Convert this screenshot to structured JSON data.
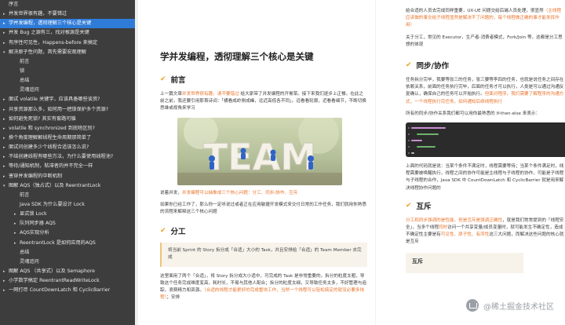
{
  "sidebar": {
    "items": [
      {
        "label": "序言",
        "level": 0,
        "tri": ""
      },
      {
        "label": "并发世界很有趣，不要错过",
        "level": 0,
        "tri": "▸"
      },
      {
        "label": "学并发编程，透彻理解三个核心是关键",
        "level": 0,
        "tri": "▸",
        "active": true
      },
      {
        "label": "并发 Bug 之源有三，找对根源是关键",
        "level": 0,
        "tri": "▸"
      },
      {
        "label": "有序性可见性，Happens-before 来搞定",
        "level": 0,
        "tri": "▸"
      },
      {
        "label": "解决原子性问题，首先需要宏观理解",
        "level": 0,
        "tri": "▾"
      },
      {
        "label": "前言",
        "level": 1,
        "tri": ""
      },
      {
        "label": "锁",
        "level": 1,
        "tri": ""
      },
      {
        "label": "总结",
        "level": 1,
        "tri": ""
      },
      {
        "label": "灵魂追问",
        "level": 1,
        "tri": ""
      },
      {
        "label": "面试 volatile 关键字，应该具备哪些谈资?",
        "level": 0,
        "tri": "▸"
      },
      {
        "label": "共享资源那么多，如何用一把锁保护多个资源?",
        "level": 0,
        "tri": "▸"
      },
      {
        "label": "如何避免死锁? 其实有套路可循",
        "level": 0,
        "tri": "▸"
      },
      {
        "label": "volatile 和 synchronized 到底啥区别?",
        "level": 0,
        "tri": "▸"
      },
      {
        "label": "换个角度理解解线程生命周期那简单了",
        "level": 0,
        "tri": "▸"
      },
      {
        "label": "面试问创建多少个线程合适该怎么说?",
        "level": 0,
        "tri": "▸"
      },
      {
        "label": "不结创建线程有哪些方法，为什么要使用线程池?",
        "level": 0,
        "tri": "▸"
      },
      {
        "label": "等待/通知机制，粘滞者的并不完全一样",
        "level": 0,
        "tri": "▸"
      },
      {
        "label": "害穿并发编程的中断机制",
        "level": 0,
        "tri": "▸"
      },
      {
        "label": "图解 AQS（独占式）以及 ReentrantLock",
        "level": 0,
        "tri": "▾"
      },
      {
        "label": "前言",
        "level": 1,
        "tri": ""
      },
      {
        "label": "Java SDK 为什么要设计 Lock",
        "level": 1,
        "tri": ""
      },
      {
        "label": "显式锁 Lock",
        "level": 1,
        "tri": "▸"
      },
      {
        "label": "队列同步器 AQS",
        "level": 1,
        "tri": "▸"
      },
      {
        "label": "AQS实现分析",
        "level": 1,
        "tri": "▸"
      },
      {
        "label": "ReentrantLock 是如何应用的AQS",
        "level": 1,
        "tri": "▸"
      },
      {
        "label": "总结",
        "level": 1,
        "tri": ""
      },
      {
        "label": "灵魂追问",
        "level": 1,
        "tri": ""
      },
      {
        "label": "图解 AQS （共享式）以及 Semaphore",
        "level": 0,
        "tri": "▸"
      },
      {
        "label": "小学数学搞定 ReentrantReadWriteLock",
        "level": 0,
        "tri": "▸"
      },
      {
        "label": "一网打尽 CountDownLatch 和 CyclicBarrier",
        "level": 0,
        "tri": "▸"
      }
    ]
  },
  "main": {
    "title": "学并发编程，透彻理解三个核心是关键",
    "section_preface": "前言",
    "preface_p1_a": "上一篇文章",
    "preface_p1_link": "并发世界很有趣，请不要错过",
    "preface_p1_b": " 给大家带了并发编程的开胃菜。接下来我们逐步上正餐。在此之前之前，我还要引用那首诗词：「横看成岭侧成峰，远近高低各不同」。远看看轮廓，近看看细节，不断切换思维或视角来学习",
    "image_label": "TEAM",
    "after_image_a": "说着并发，",
    "after_image_hl": "并发编程可以抽象成三个核心问题：分工、同步/协作、互斥",
    "after_image_p": "如果你已经工作了，那么你一定听说过或者正在应用敏捷开发模式来交付日常的工作任务，我们就用你熟悉的流程来解释这三个核心问题",
    "section_division": "分工",
    "quote": "将当前 Sprint 的 Story 拆分成「合适」大小的 Task，并且安排给「合适」的 Team Member 去完成",
    "division_p_a": "这里面用了两个「合适」，将 Story 拆分成大小适中，可完成的 Task 是非常重要的。拆分的粒度太粗，导致这个任务完成难度变高，耗时长，不易与其他人配合；拆分的粒度太细，又导致任务太多，不好管理与追踪，浪费精力和资源。",
    "division_p_hl": "（合适的线程才能更好的完成整块工作，当然一个线程可以轻松搞定的就没必要多线程）",
    "division_p_b": "；安排"
  },
  "right": {
    "p1_a": "给合适的人员去完成同样重要，UX-UE 问题交给后端人员处理，很显然",
    "p1_hl": "（主线程应该做的事交给子线程显然是解决不了问题的，每个线程做正确的事才能发挥作用）",
    "p2": "关于分工，常见的 Executor，生产者-消费者模式，Fork/Join 等，这都是分工思想的体现",
    "section_sync": "同步/协作",
    "sync_p1_a": "任务拆分完毕，我要等张三的任务，张三要等李四的任务，也就是说任务之间存在依赖关系，前面的任务执行完毕，后面的任务才可以执行，人类是可以通过沟通反复确认，确保自己的任务可以开始执行。",
    "sync_p1_hl": "但面对程序，我们需要了解程序的沟通方式，一个线程执行完任务，如何通知后续线程执行",
    "sync_p2": "所有的同步/协作关系我们都可以用你最熟悉的 If-then-else 来表示：",
    "sync_p3": "上面的代码就是说：当某个条件不满足时，线程需要等待；当某个条件满足时，线程需要被唤醒执行，线程之间的协作可能是主线程与子线程的协作，可能是子线程与子线程的合作，Java SDK 中 CountDownLatch 和 CyclicBarrier 就是用来解决线程协作问题的",
    "section_mutex": "互斥",
    "mutex_p1_hl": "分工和同步强调的是性能，但是互斥是强调正确性",
    "mutex_p1_b": "，就是我们常常提到的「线程安全」，当多个线程",
    "mutex_p1_hl2": "同时",
    "mutex_p1_c": "访问一个共享变量/成员变量时，就可能发生不确定性，造成不确定性主要是有",
    "mutex_p1_hl3": "可见性、原子性、有序性",
    "mutex_p1_d": "这三大问题，而解决这些问题的核心就是互斥",
    "mutex_box": "互斥"
  },
  "watermark": "@稀土掘金技术社区",
  "colors": {
    "sidebar_bg": "#3d3d3d",
    "active": "#2f7bd8",
    "accent": "#e8742b",
    "check": "#f0a01a"
  }
}
